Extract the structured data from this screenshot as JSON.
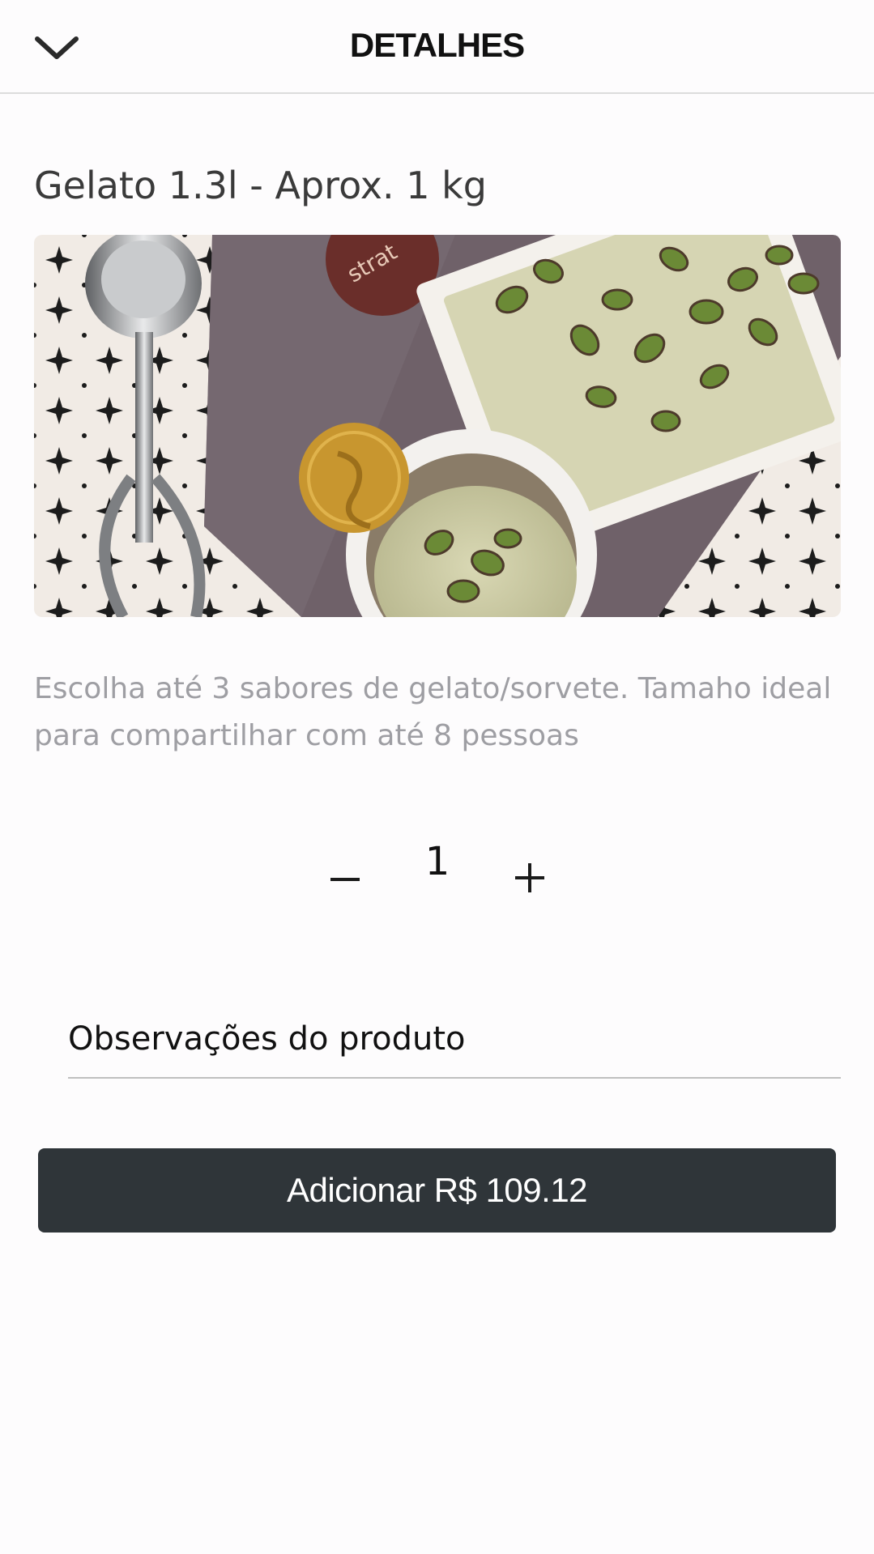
{
  "header": {
    "title": "DETALHES",
    "back_icon": "chevron-down-icon"
  },
  "product": {
    "title": "Gelato 1.3l - Aprox. 1 kg",
    "image_alt": "pistachio-gelato-photo",
    "description": "Escolha até 3 sabores de gelato/sorvete. Tamaho ideal para compartilhar com até 8 pessoas",
    "image_text": "strat"
  },
  "quantity": {
    "value": "1",
    "decrement_icon": "minus-icon",
    "increment_icon": "plus-icon"
  },
  "notes": {
    "placeholder": "Observações do produto",
    "value": ""
  },
  "add_button": {
    "label": "Adicionar R$ 109.12"
  },
  "colors": {
    "button_bg": "#2f3539",
    "description_text": "#9e9ea3",
    "background": "#fdfcfd"
  }
}
